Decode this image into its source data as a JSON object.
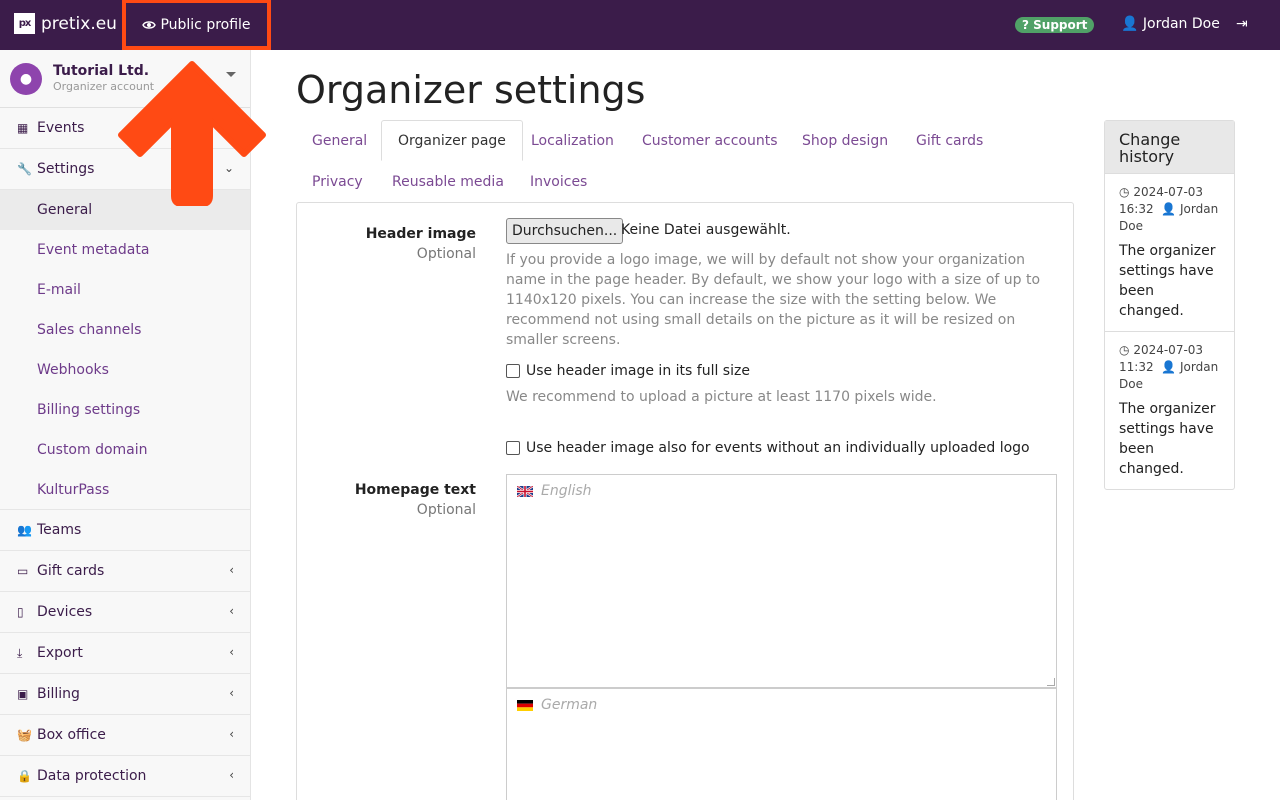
{
  "topbar": {
    "brand_icon": "px",
    "brand_name": "pretix.eu",
    "public_profile": "Public profile",
    "support": "Support",
    "user": "Jordan Doe",
    "logout_icon": "sign-out-icon"
  },
  "sidebar": {
    "org_name": "Tutorial Ltd.",
    "org_sub": "Organizer account",
    "events": "Events",
    "settings": "Settings",
    "settings_sub": [
      "General",
      "Event metadata",
      "E-mail",
      "Sales channels",
      "Webhooks",
      "Billing settings",
      "Custom domain",
      "KulturPass"
    ],
    "teams": "Teams",
    "gift_cards": "Gift cards",
    "devices": "Devices",
    "export": "Export",
    "billing": "Billing",
    "box_office": "Box office",
    "data_protection": "Data protection"
  },
  "main": {
    "title": "Organizer settings",
    "tabs": [
      "General",
      "Organizer page",
      "Localization",
      "Customer accounts",
      "Shop design",
      "Gift cards",
      "Privacy",
      "Reusable media",
      "Invoices"
    ],
    "header_image_label": "Header image",
    "optional": "Optional",
    "file_button": "Durchsuchen...",
    "file_status": "Keine Datei ausgewählt.",
    "header_help": "If you provide a logo image, we will by default not show your organization name in the page header. By default, we show your logo with a size of up to 1140x120 pixels. You can increase the size with the setting below. We recommend not using small details on the picture as it will be resized on smaller screens.",
    "full_size_label": "Use header image in its full size",
    "full_size_help": "We recommend to upload a picture at least 1170 pixels wide.",
    "also_events_label": "Use header image also for events without an individually uploaded logo",
    "homepage_text_label": "Homepage text",
    "lang_en": "English",
    "lang_de": "German"
  },
  "history": {
    "title": "Change history",
    "entries": [
      {
        "date": "2024-07-03",
        "time": "16:32",
        "user": "Jordan Doe",
        "text": "The organizer settings have been changed."
      },
      {
        "date": "2024-07-03",
        "time": "11:32",
        "user": "Jordan Doe",
        "text": "The organizer settings have been changed."
      }
    ]
  },
  "colors": {
    "topbar": "#3b1c4a",
    "highlight": "#ff4a14",
    "link": "#7b4a93",
    "support": "#50a167"
  }
}
